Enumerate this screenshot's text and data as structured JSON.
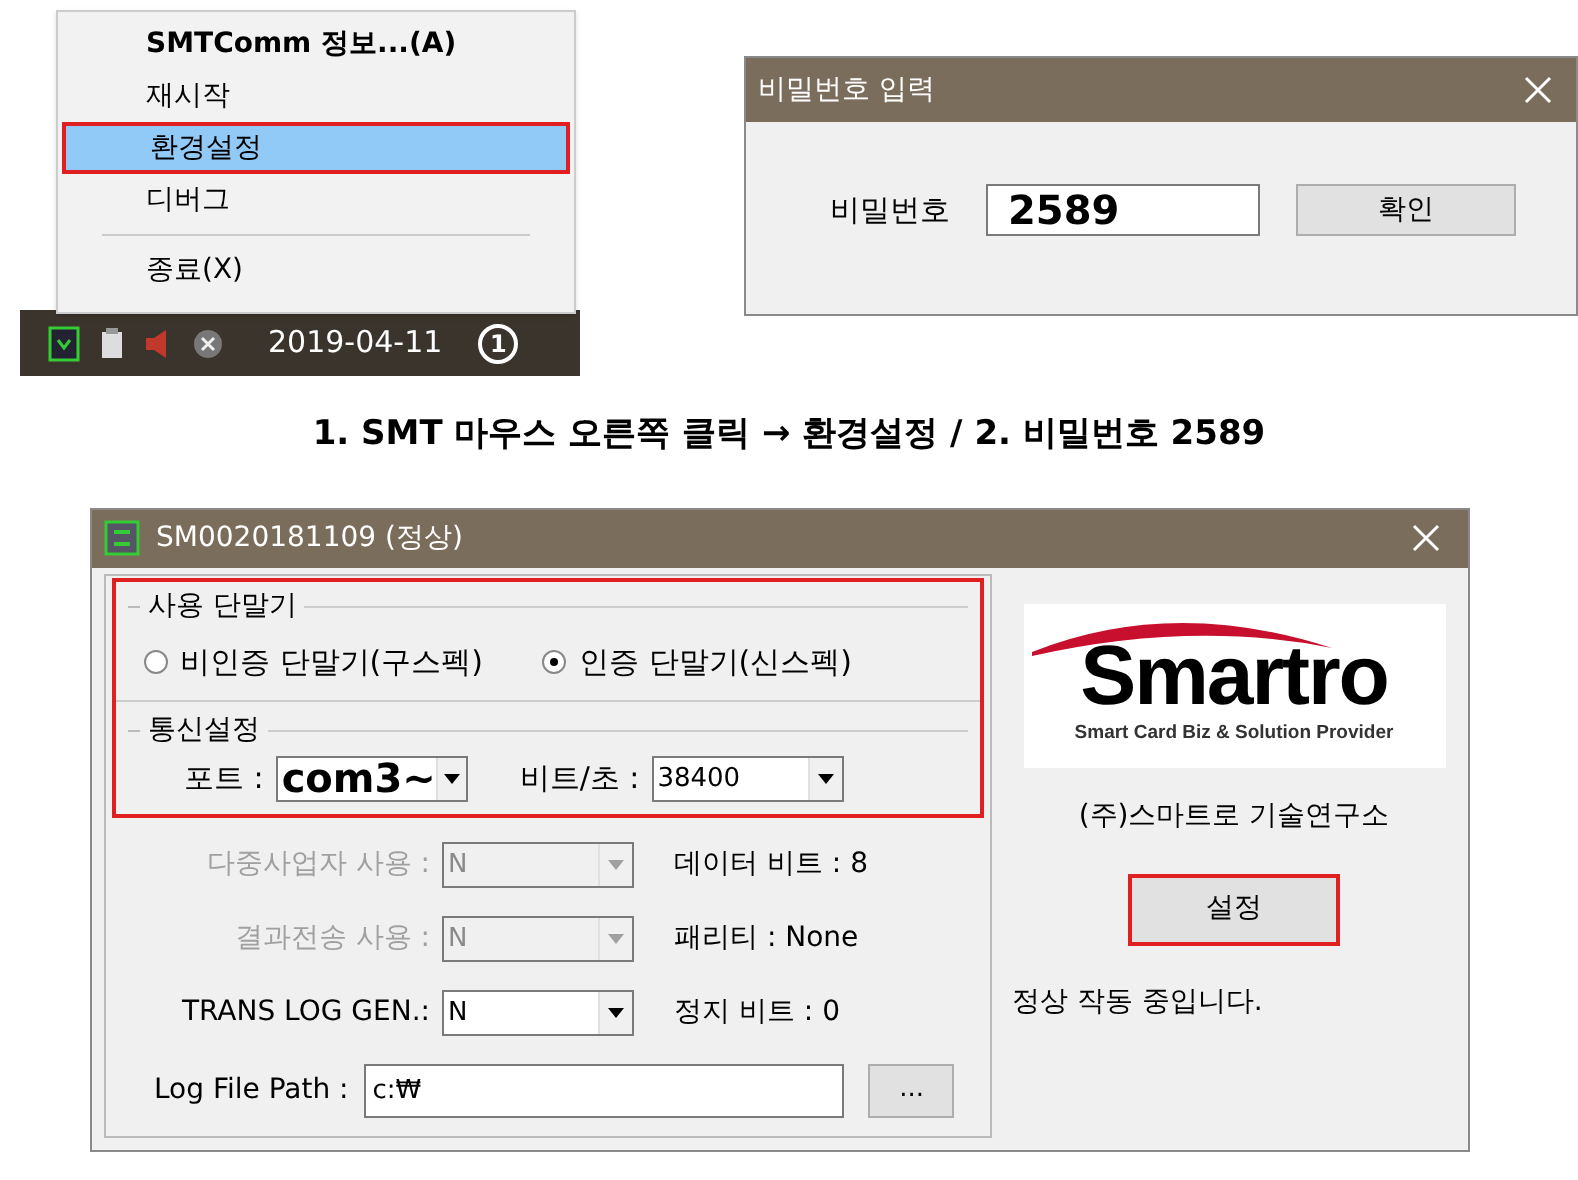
{
  "tray_menu": {
    "items": [
      {
        "kind": "item",
        "label": "SMTComm 정보...(A)",
        "bold": true,
        "selected": false
      },
      {
        "kind": "item",
        "label": "재시작",
        "bold": false,
        "selected": false
      },
      {
        "kind": "item",
        "label": "환경설정",
        "bold": false,
        "selected": true
      },
      {
        "kind": "item",
        "label": "디버그",
        "bold": false,
        "selected": false
      },
      {
        "kind": "separator"
      },
      {
        "kind": "item",
        "label": "종료(X)",
        "bold": false,
        "selected": false
      }
    ]
  },
  "taskbar": {
    "date": "2019-04-11",
    "notification_count": "1"
  },
  "password_dialog": {
    "title": "비밀번호 입력",
    "label": "비밀번호",
    "value": "2589",
    "button": "확인"
  },
  "caption": "1. SMT 마우스 오른쪽 클릭 → 환경설정 / 2. 비밀번호 2589",
  "settings_window": {
    "title": "SM0020181109 (정상)",
    "annotated": true,
    "terminal_group": {
      "title": "사용 단말기",
      "options": [
        {
          "label": "비인증 단말기(구스펙)",
          "selected": false
        },
        {
          "label": "인증 단말기(신스펙)",
          "selected": true
        }
      ]
    },
    "comm_group": {
      "title": "통신설정",
      "port_label": "포트 :",
      "port_value": "com3~",
      "baud_label": "비트/초 :",
      "baud_value": "38400"
    },
    "fields": [
      {
        "label": "다중사업자 사용 :",
        "value": "N",
        "disabled": true,
        "info": "데이터 비트 : 8"
      },
      {
        "label": "결과전송 사용 :",
        "value": "N",
        "disabled": true,
        "info": "패리티 : None"
      },
      {
        "label": "TRANS LOG GEN.:",
        "value": "N",
        "disabled": false,
        "info": "정지 비트 : 0"
      }
    ],
    "log_path": {
      "label": "Log File Path :",
      "value": "c:₩",
      "browse": "..."
    },
    "logo": {
      "name": "Smartro",
      "tagline": "Smart Card Biz & Solution Provider"
    },
    "company": "(주)스마트로 기술연구소",
    "settings_button": {
      "label": "설정",
      "annotated": true
    },
    "status": "정상 작동 중입니다."
  }
}
